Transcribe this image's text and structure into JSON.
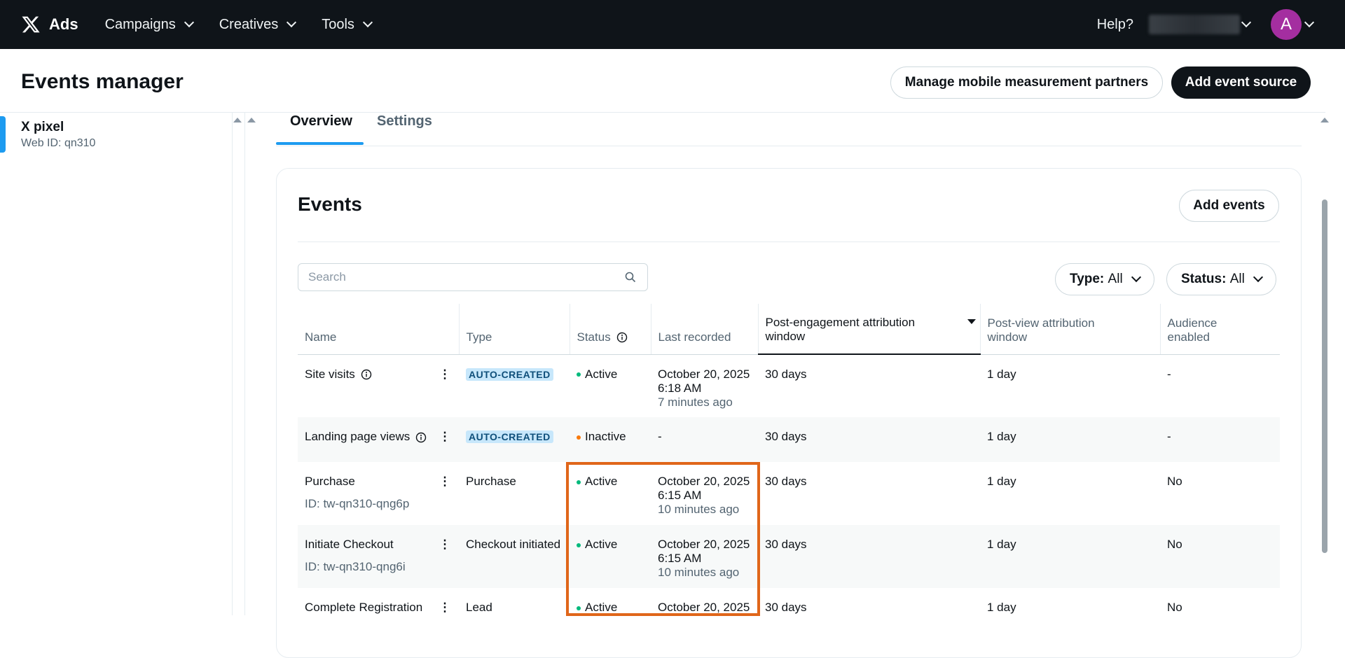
{
  "nav": {
    "brand": "Ads",
    "items": [
      {
        "label": "Campaigns"
      },
      {
        "label": "Creatives"
      },
      {
        "label": "Tools"
      }
    ],
    "help": "Help?",
    "avatar_letter": "A",
    "avatar_color": "#a42ea0"
  },
  "header": {
    "title": "Events manager",
    "manage_partners": "Manage mobile measurement partners",
    "add_source": "Add event source"
  },
  "sidebar": {
    "title": "X pixel",
    "subtitle": "Web ID: qn310"
  },
  "tabs": {
    "overview": "Overview",
    "settings": "Settings"
  },
  "events": {
    "title": "Events",
    "add_events": "Add events",
    "search_placeholder": "Search",
    "type_filter_key": "Type:",
    "type_filter_val": "All",
    "status_filter_key": "Status:",
    "status_filter_val": "All",
    "columns": {
      "name": "Name",
      "type": "Type",
      "status": "Status",
      "last_recorded": "Last recorded",
      "post_engagement": "Post-engagement attribution window",
      "post_view": "Post-view attribution window",
      "audience": "Audience enabled"
    },
    "rows": [
      {
        "name": "Site visits",
        "id": "",
        "type": "AUTO-CREATED",
        "status": "Active",
        "date": "October 20, 2025",
        "time": "6:18 AM",
        "ago": "7 minutes ago",
        "pe": "30 days",
        "pv": "1 day",
        "aud": "-"
      },
      {
        "name": "Landing page views",
        "id": "",
        "type": "AUTO-CREATED",
        "status": "Inactive",
        "date": "-",
        "time": "",
        "ago": "",
        "pe": "30 days",
        "pv": "1 day",
        "aud": "-"
      },
      {
        "name": "Purchase",
        "id": "ID: tw-qn310-qng6p",
        "type": "Purchase",
        "status": "Active",
        "date": "October 20, 2025",
        "time": "6:15 AM",
        "ago": "10 minutes ago",
        "pe": "30 days",
        "pv": "1 day",
        "aud": "No"
      },
      {
        "name": "Initiate Checkout",
        "id": "ID: tw-qn310-qng6i",
        "type": "Checkout initiated",
        "status": "Active",
        "date": "October 20, 2025",
        "time": "6:15 AM",
        "ago": "10 minutes ago",
        "pe": "30 days",
        "pv": "1 day",
        "aud": "No"
      },
      {
        "name": "Complete Registration",
        "id": "",
        "type": "Lead",
        "status": "Active",
        "date": "October 20, 2025",
        "time": "",
        "ago": "",
        "pe": "30 days",
        "pv": "1 day",
        "aud": "No"
      }
    ]
  },
  "colors": {
    "active": "#00ba7c",
    "inactive": "#f97a0c",
    "accent": "#1d9bf0",
    "highlight": "#e0661a"
  }
}
